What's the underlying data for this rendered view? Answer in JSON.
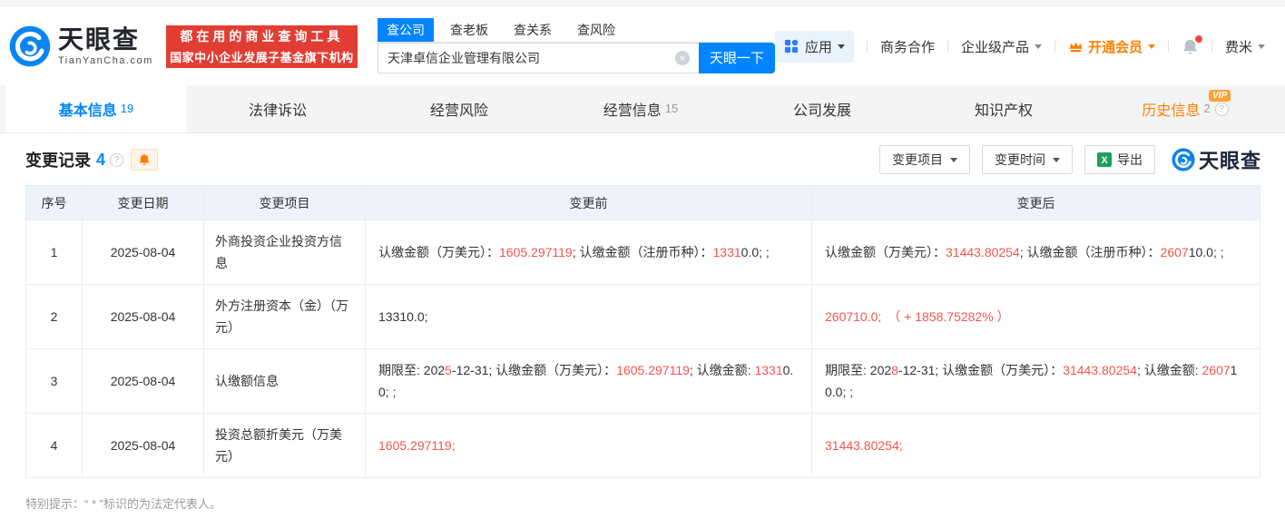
{
  "colors": {
    "accent_blue": "#0084ff",
    "brand_red_banner": "#e23d33",
    "diff_red": "#f2564d",
    "vip_orange": "#ff8000"
  },
  "icons": {
    "help": "?",
    "clear": "×",
    "vip_badge": "VIP",
    "excel_letter": "X"
  },
  "header": {
    "logo": {
      "brand": "天眼查",
      "domain": "TianYanCha.com"
    },
    "slogan": {
      "line1": "都在用的商业查询工具",
      "line2": "国家中小企业发展子基金旗下机构"
    },
    "search": {
      "tabs": [
        {
          "label": "查公司",
          "active": true
        },
        {
          "label": "查老板",
          "active": false
        },
        {
          "label": "查关系",
          "active": false
        },
        {
          "label": "查风险",
          "active": false
        }
      ],
      "value": "天津卓信企业管理有限公司",
      "button": "天眼一下"
    },
    "nav": {
      "apps": "应用",
      "coop": "商务合作",
      "enterprise": "企业级产品",
      "vip": "开通会员",
      "user": "费米"
    }
  },
  "tabs": [
    {
      "label": "基本信息",
      "count": "19",
      "active": true
    },
    {
      "label": "法律诉讼"
    },
    {
      "label": "经营风险"
    },
    {
      "label": "经营信息",
      "count": "15"
    },
    {
      "label": "公司发展"
    },
    {
      "label": "知识产权"
    },
    {
      "label": "历史信息",
      "count": "2",
      "vip": true,
      "help": true
    }
  ],
  "section": {
    "title": "变更记录",
    "count": "4",
    "filters": {
      "project": "变更项目",
      "time": "变更时间",
      "export": "导出"
    },
    "watermark": "天眼查"
  },
  "table": {
    "headers": [
      "序号",
      "变更日期",
      "变更项目",
      "变更前",
      "变更后"
    ],
    "rows": [
      {
        "no": "1",
        "date": "2025-08-04",
        "item": "外商投资企业投资方信息",
        "before": [
          {
            "t": "认缴金额（万美元）：",
            "r": false
          },
          {
            "t": "1605.297119",
            "r": true
          },
          {
            "t": "; 认缴金额（注册币种）：",
            "r": false
          },
          {
            "t": "1331",
            "r": true
          },
          {
            "t": "0.0; ;",
            "r": false
          }
        ],
        "after": [
          {
            "t": "认缴金额（万美元）：",
            "r": false
          },
          {
            "t": "31443.80254",
            "r": true
          },
          {
            "t": "; 认缴金额（注册币种）：",
            "r": false
          },
          {
            "t": "2607",
            "r": true
          },
          {
            "t": "10.0; ;",
            "r": false
          }
        ]
      },
      {
        "no": "2",
        "date": "2025-08-04",
        "item": "外方注册资本（金）（万元）",
        "before": [
          {
            "t": "13310.0;",
            "r": false
          }
        ],
        "after": [
          {
            "t": "260710.0;",
            "r": true
          },
          {
            "t": "　",
            "r": false
          },
          {
            "t": "（ + 1858.75282% ）",
            "r": true
          }
        ]
      },
      {
        "no": "3",
        "date": "2025-08-04",
        "item": "认缴额信息",
        "before": [
          {
            "t": "期限至: 202",
            "r": false
          },
          {
            "t": "5",
            "r": true
          },
          {
            "t": "-12-31; 认缴金额（万美元）：",
            "r": false
          },
          {
            "t": "1605.297119",
            "r": true
          },
          {
            "t": "; 认缴金额: ",
            "r": false
          },
          {
            "t": "1331",
            "r": true
          },
          {
            "t": "0.0; ;",
            "r": false
          }
        ],
        "after": [
          {
            "t": "期限至: 202",
            "r": false
          },
          {
            "t": "8",
            "r": true
          },
          {
            "t": "-12-31; 认缴金额（万美元）：",
            "r": false
          },
          {
            "t": "31443.80254",
            "r": true
          },
          {
            "t": "; 认缴金额: ",
            "r": false
          },
          {
            "t": "2607",
            "r": true
          },
          {
            "t": "10.0; ;",
            "r": false
          }
        ]
      },
      {
        "no": "4",
        "date": "2025-08-04",
        "item": "投资总额折美元（万美元）",
        "before": [
          {
            "t": "1605.297119;",
            "r": true
          }
        ],
        "after": [
          {
            "t": "31443.80254;",
            "r": true
          }
        ]
      }
    ]
  },
  "footer": {
    "note": "特别提示：“ * ”标识的为法定代表人。"
  }
}
